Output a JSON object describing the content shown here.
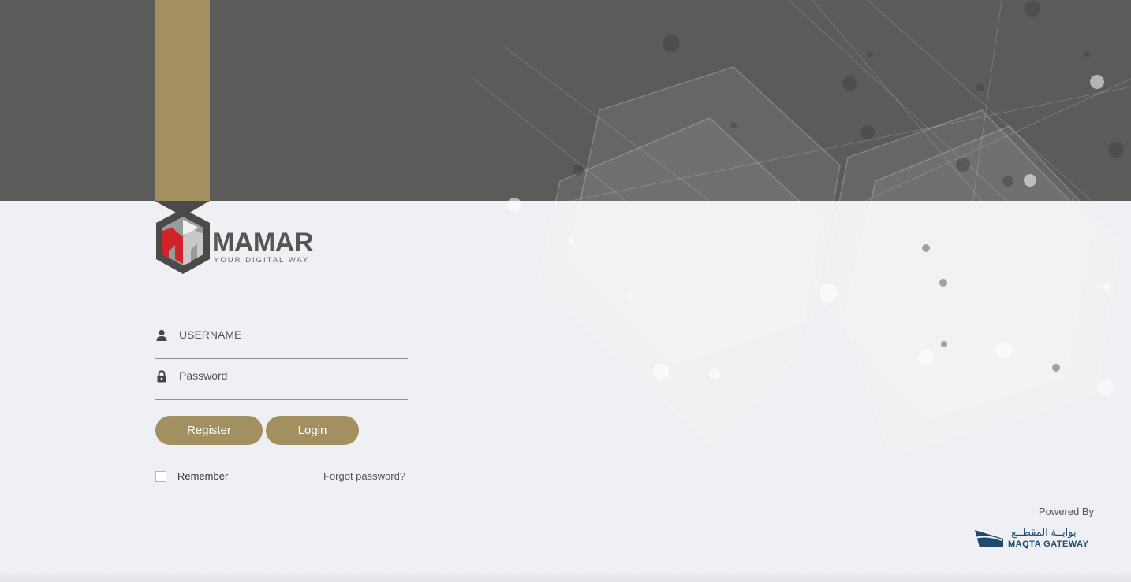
{
  "brand": {
    "name": "MAMAR",
    "tagline": "YOUR DIGITAL WAY"
  },
  "form": {
    "username_placeholder": "USERNAME",
    "password_placeholder": "Password",
    "register_label": "Register",
    "login_label": "Login",
    "remember_label": "Remember",
    "remember_checked": false,
    "forgot_label": "Forgot password?"
  },
  "footer": {
    "powered_by": "Powered By",
    "partner_name_ar": "بوابــة المقطــع",
    "partner_name_en": "MAQTA GATEWAY"
  },
  "icons": {
    "username": "user-icon",
    "password": "lock-icon"
  },
  "colors": {
    "accent_gold": "#a39060",
    "banner_gray": "#5b5b5b",
    "page_bg": "#eff0f3",
    "logo_red": "#d2232a",
    "partner_navy": "#1f4a6e"
  }
}
